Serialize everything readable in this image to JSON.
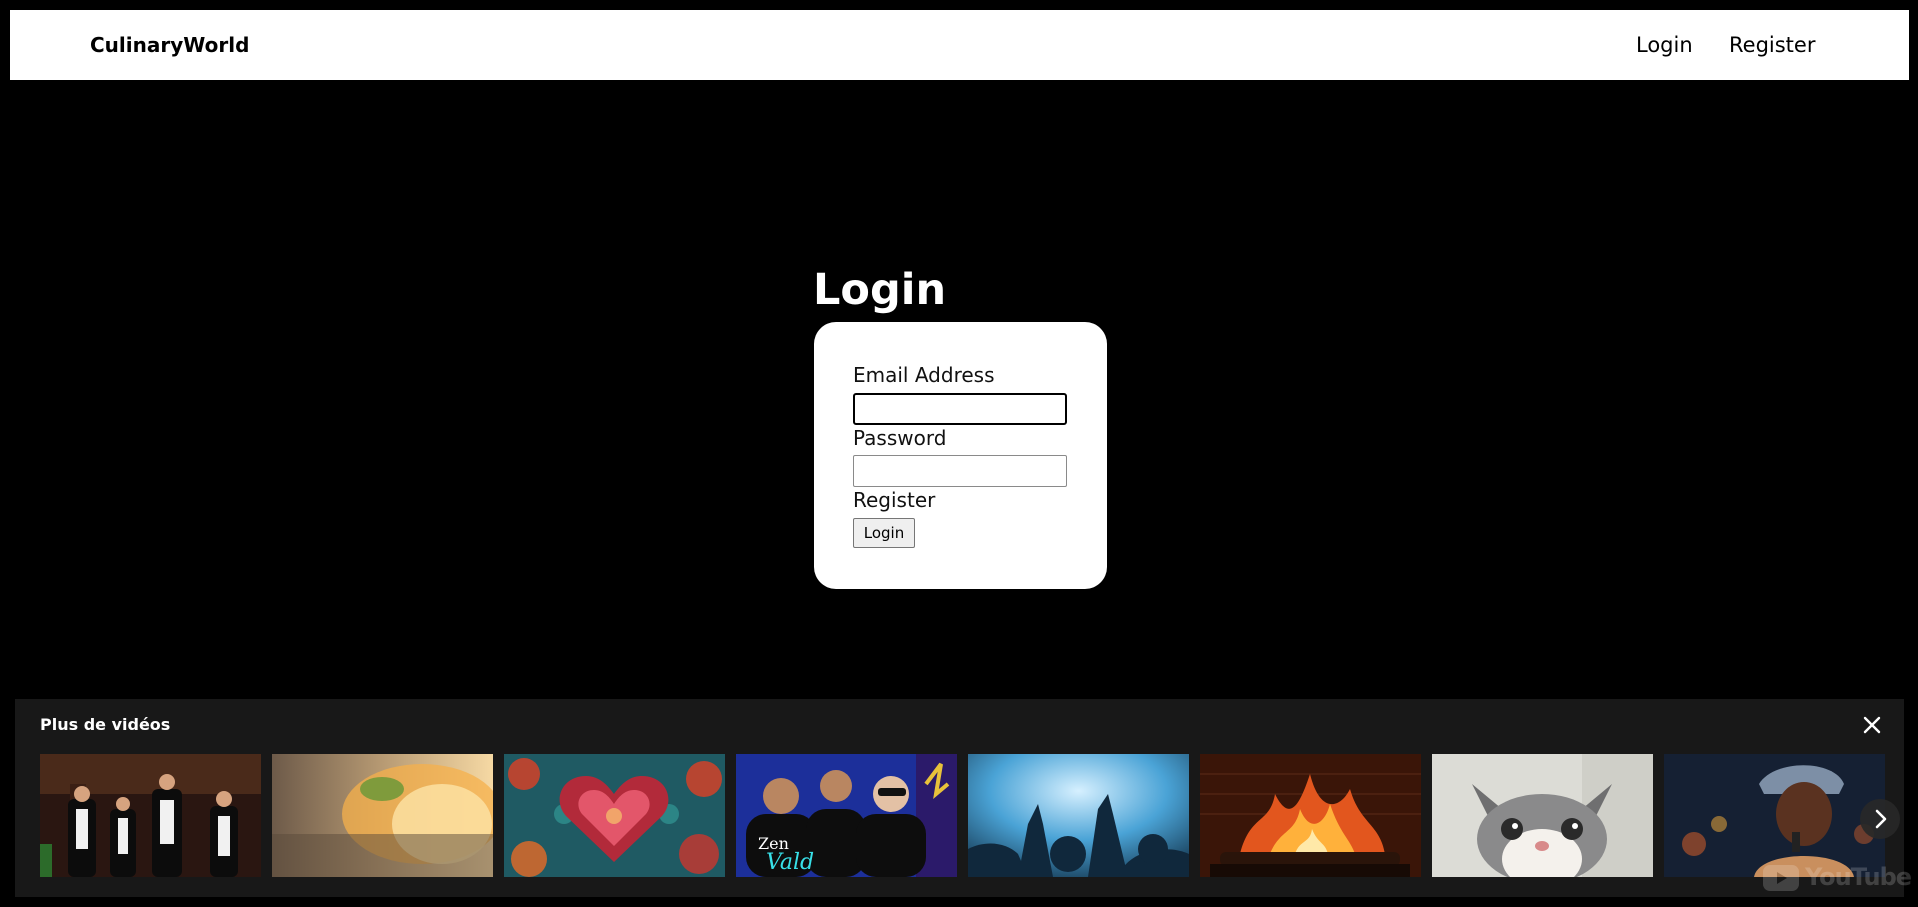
{
  "navbar": {
    "brand": "CulinaryWorld",
    "links": [
      {
        "label": "Login"
      },
      {
        "label": "Register"
      }
    ]
  },
  "login": {
    "title": "Login",
    "email_label": "Email Address",
    "email_value": "",
    "password_label": "Password",
    "password_value": "",
    "register_link": "Register",
    "submit_label": "Login"
  },
  "more_videos": {
    "title": "Plus de vidéos",
    "close_icon": "close-icon",
    "next_icon": "chevron-right-icon",
    "watermark": "YouTube",
    "thumbnails": [
      {
        "label": "Zen",
        "subtitle": "Vald"
      }
    ]
  }
}
